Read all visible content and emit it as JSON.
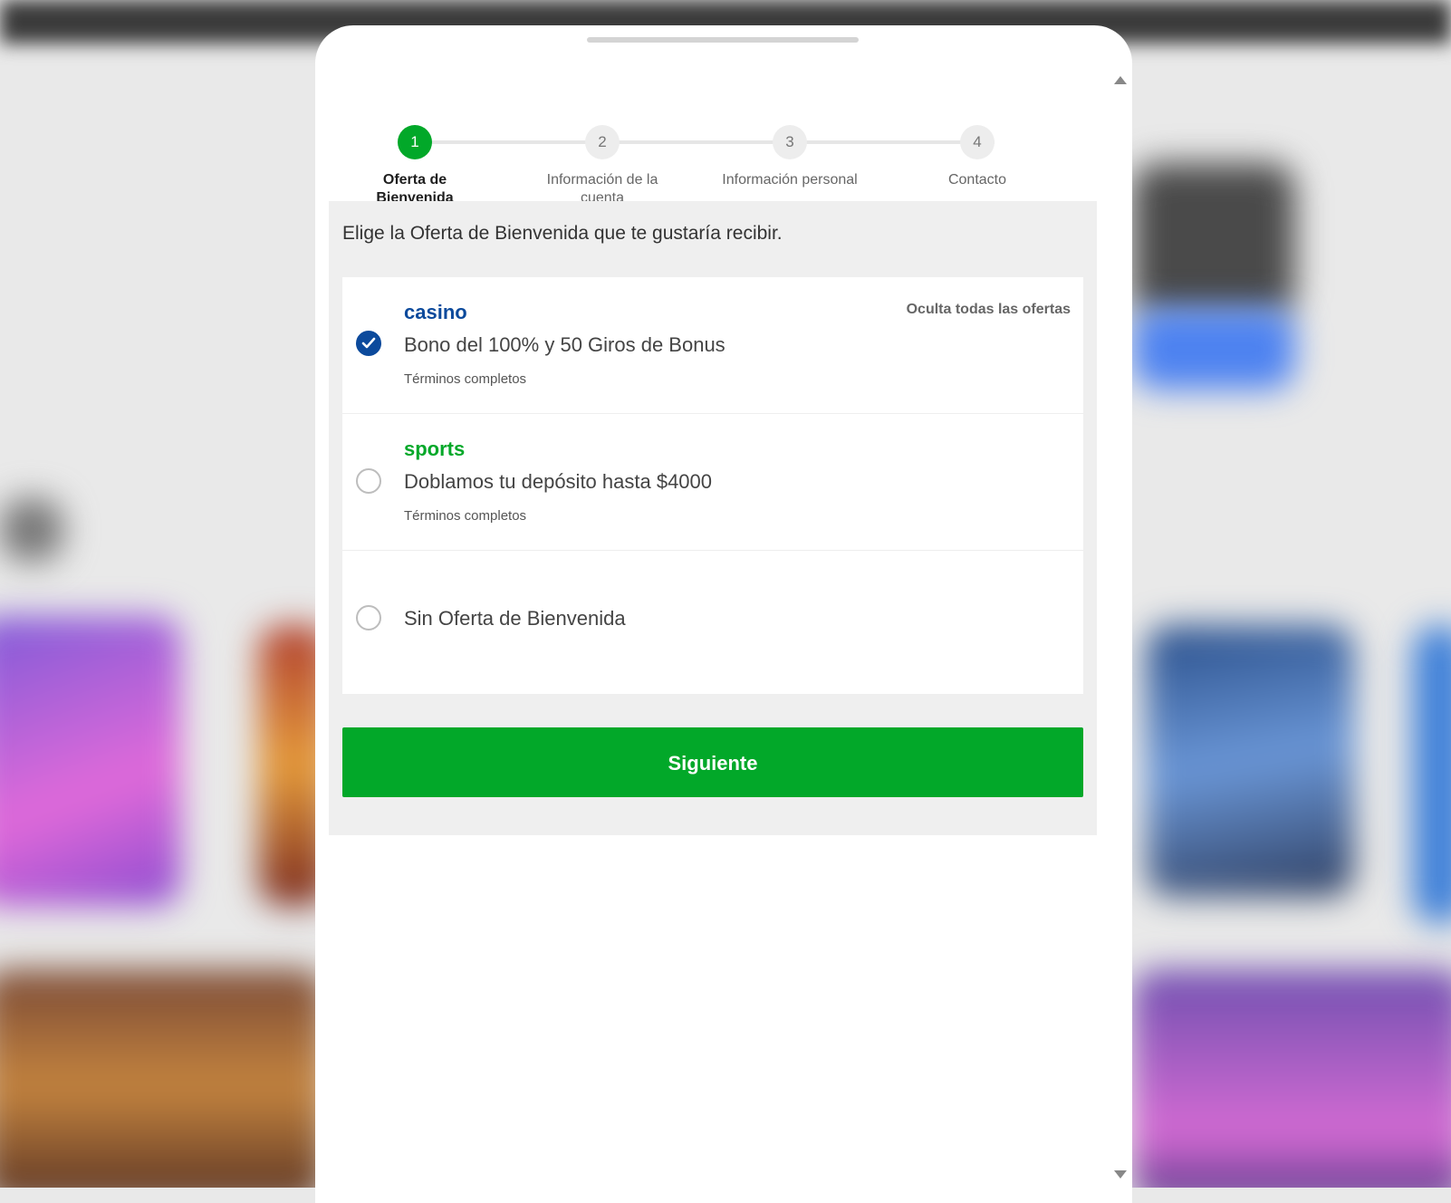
{
  "stepper": {
    "steps": [
      {
        "number": "1",
        "label": "Oferta de Bienvenida"
      },
      {
        "number": "2",
        "label": "Información de la cuenta"
      },
      {
        "number": "3",
        "label": "Información personal"
      },
      {
        "number": "4",
        "label": "Contacto"
      }
    ],
    "active_step": 1
  },
  "panel": {
    "intro": "Elige la Oferta de Bienvenida que te gustaría recibir.",
    "hide_offers_label": "Oculta todas las ofertas",
    "offers": [
      {
        "title": "casino",
        "description": "Bono del 100% y 50 Giros de Bonus",
        "terms": "Términos completos",
        "selected": true
      },
      {
        "title": "sports",
        "description": "Doblamos tu depósito hasta $4000",
        "terms": "Términos completos",
        "selected": false
      },
      {
        "title": "",
        "description": "Sin Oferta de Bienvenida",
        "terms": "",
        "selected": false
      }
    ],
    "next_button_label": "Siguiente"
  },
  "colors": {
    "accent_green": "#02a829",
    "casino_blue": "#0c4a9c",
    "panel_gray": "#efefef"
  }
}
